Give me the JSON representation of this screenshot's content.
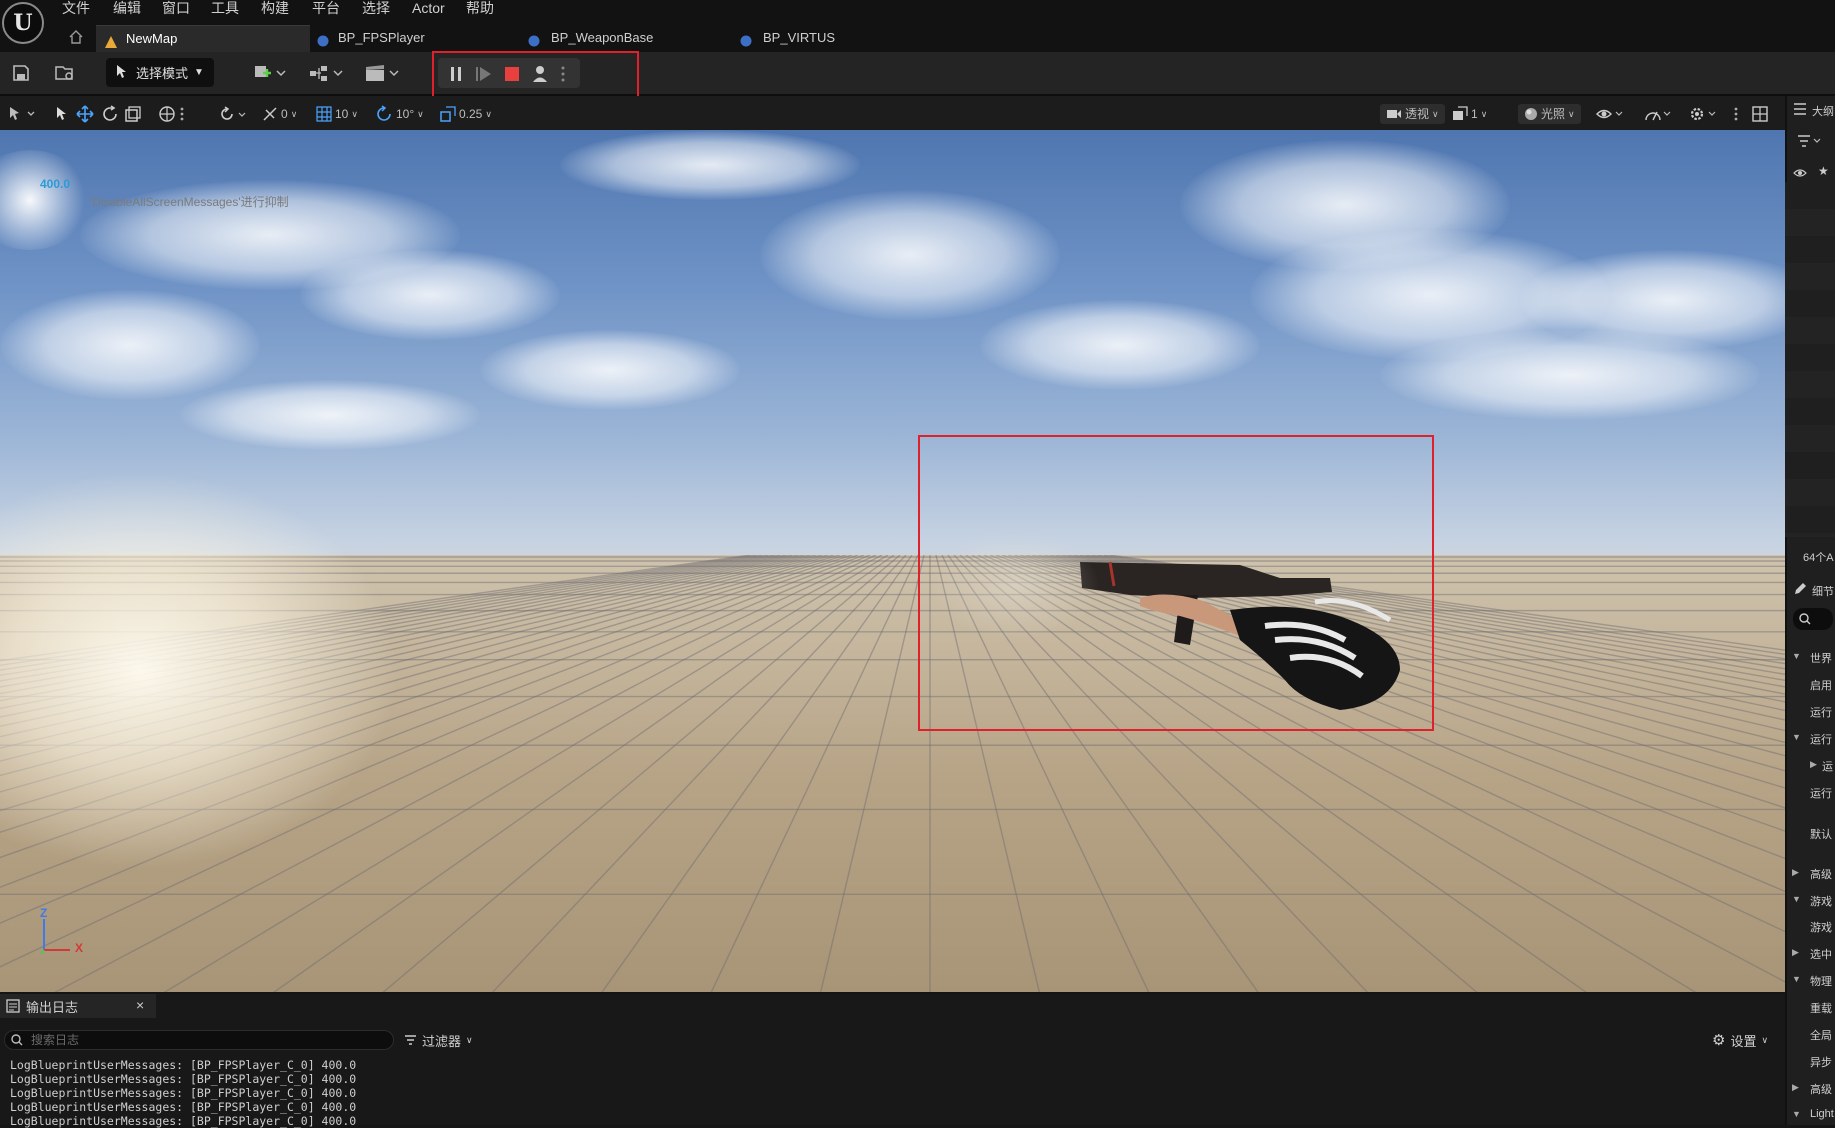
{
  "menu": [
    "文件",
    "编辑",
    "窗口",
    "工具",
    "构建",
    "平台",
    "选择",
    "Actor",
    "帮助"
  ],
  "tabs": [
    {
      "label": "NewMap",
      "active": true
    },
    {
      "label": "BP_FPSPlayer",
      "active": false
    },
    {
      "label": "BP_WeaponBase",
      "active": false
    },
    {
      "label": "BP_VIRTUS",
      "active": false
    }
  ],
  "toolbar": {
    "mode_label": "选择模式"
  },
  "viewport_toolbar": {
    "rotate_snap": "0",
    "grid_snap": "10",
    "angle_snap": "10°",
    "scale_snap": "0.25",
    "view_mode": "透视",
    "camera_speed": "1",
    "lighting": "光照"
  },
  "viewport": {
    "fps_value": "400.0",
    "suppress_msg": "'DisableAllScreenMessages'进行抑制",
    "axis_z": "Z",
    "axis_x": "X"
  },
  "right_panel": {
    "outliner_title": "大纲",
    "actor_count": "64个A",
    "details_title": "细节",
    "rows": [
      "世界",
      "启用",
      "运行",
      "运行",
      "运",
      "运行",
      "默认",
      "高级",
      "游戏",
      "游戏",
      "选中",
      "物理",
      "重载",
      "全局",
      "异步",
      "高级",
      "Light"
    ]
  },
  "output_log": {
    "tab_label": "输出日志",
    "search_placeholder": "搜索日志",
    "filter_label": "过滤器",
    "settings_label": "设置",
    "lines": [
      "LogBlueprintUserMessages: [BP_FPSPlayer_C_0] 400.0",
      "LogBlueprintUserMessages: [BP_FPSPlayer_C_0] 400.0",
      "LogBlueprintUserMessages: [BP_FPSPlayer_C_0] 400.0",
      "LogBlueprintUserMessages: [BP_FPSPlayer_C_0] 400.0",
      "LogBlueprintUserMessages: [BP_FPSPlayer_C_0] 400.0"
    ]
  },
  "colors": {
    "highlight": "#e0202a",
    "stop": "#e8403c",
    "accent_blue": "#4aa3ff"
  }
}
